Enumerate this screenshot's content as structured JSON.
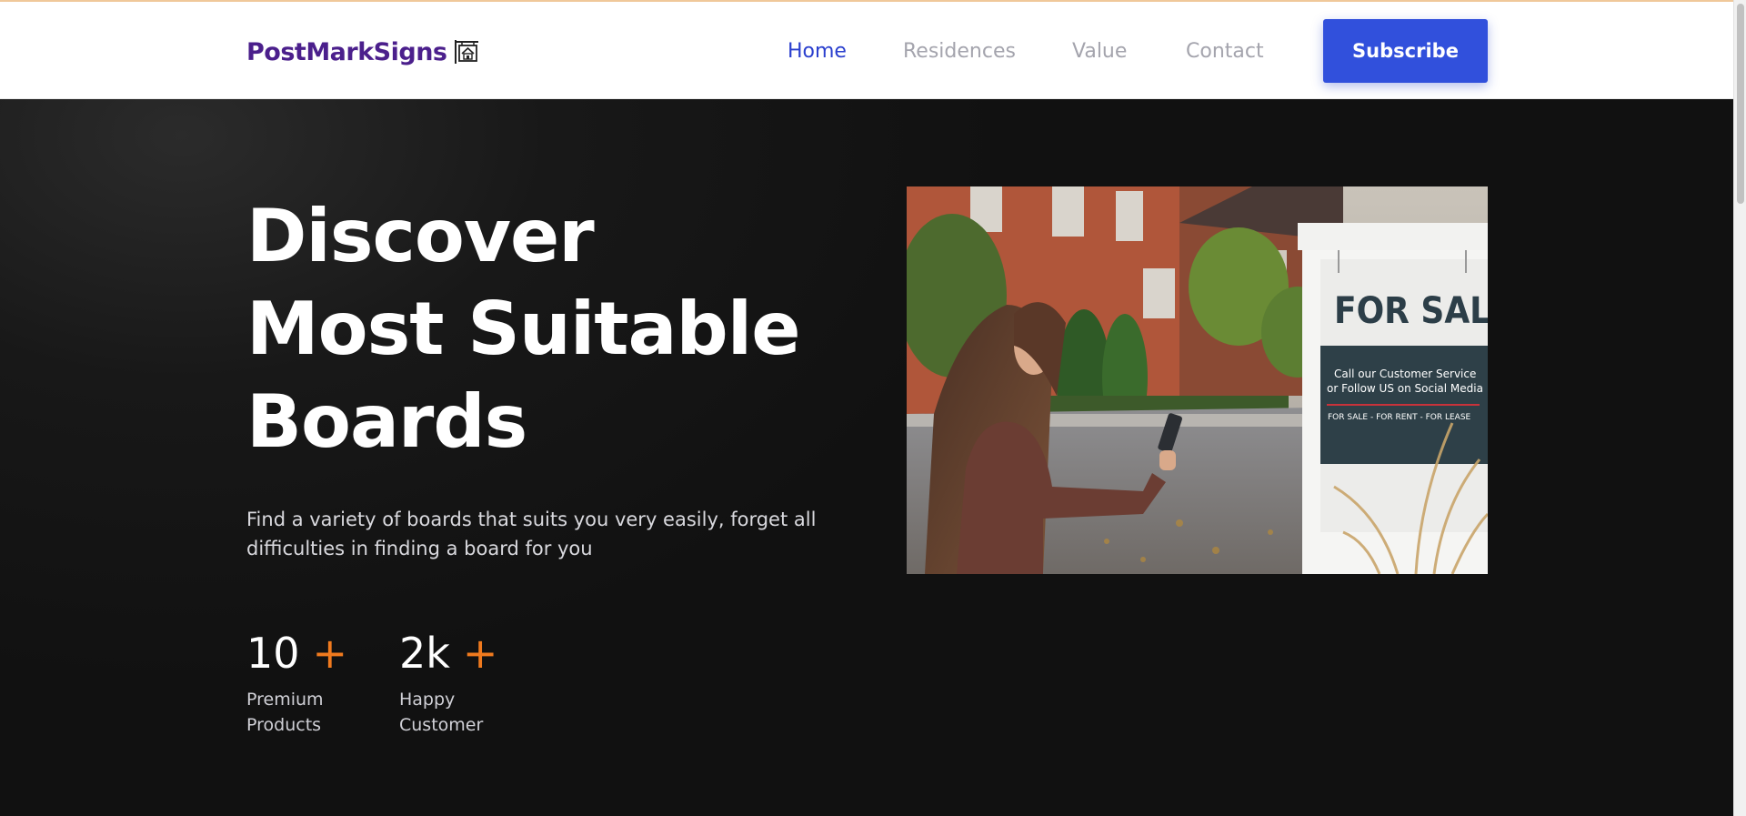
{
  "brand": {
    "name": "PostMarkSigns",
    "icon": "house-sign-icon"
  },
  "nav": {
    "items": [
      {
        "label": "Home",
        "active": true
      },
      {
        "label": "Residences",
        "active": false
      },
      {
        "label": "Value",
        "active": false
      },
      {
        "label": "Contact",
        "active": false
      }
    ],
    "subscribe_label": "Subscribe"
  },
  "hero": {
    "title_lines": [
      "Discover",
      "Most Suitable",
      "Boards"
    ],
    "subtitle": "Find a variety of boards that suits you very easily, forget all difficulties in finding a board for you",
    "stats": [
      {
        "value": "10",
        "plus": "+",
        "label": "Premium Products"
      },
      {
        "value": "2k",
        "plus": "+",
        "label": "Happy Customer"
      }
    ],
    "image": {
      "sign_title": "FOR SALE",
      "sign_line1": "Call our Customer Service",
      "sign_line2": "or Follow US on Social Media",
      "sign_footer": "FOR SALE - FOR RENT - FOR LEASE"
    }
  },
  "colors": {
    "brand": "#4b1f8c",
    "nav_active": "#2a3fce",
    "nav_inactive": "#a4a4ad",
    "button": "#3150dc",
    "accent_plus": "#f07a1e",
    "hero_bg": "#111111"
  }
}
